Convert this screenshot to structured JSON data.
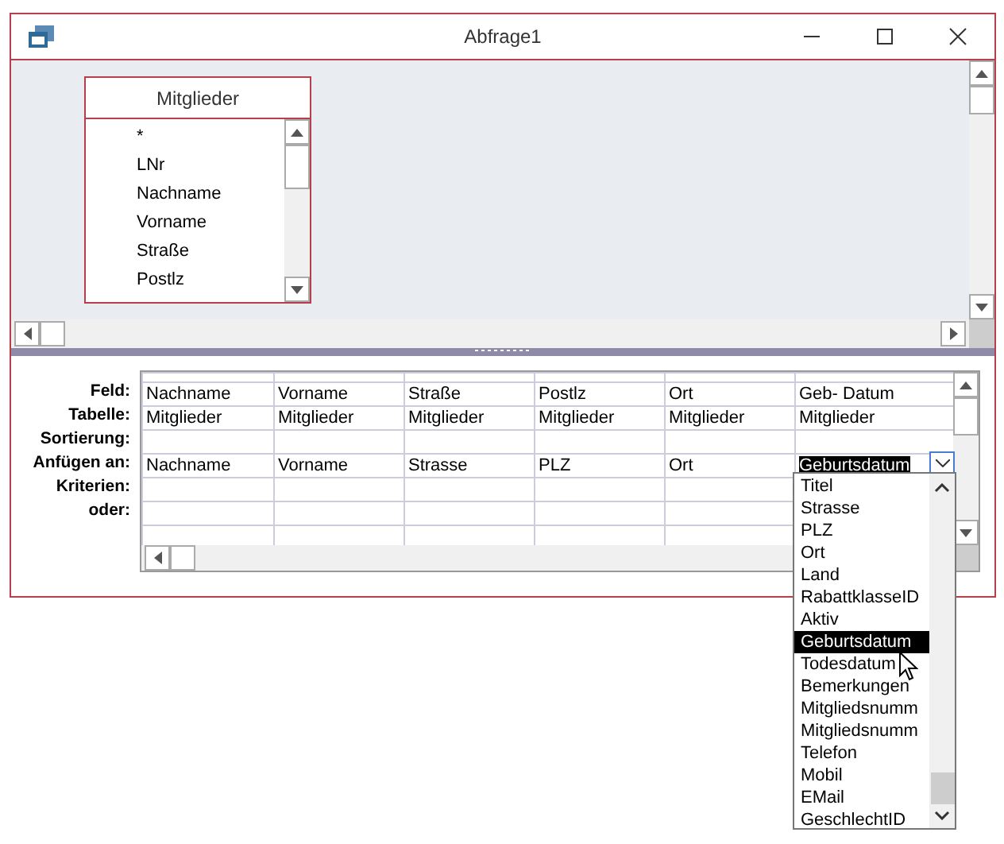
{
  "window": {
    "title": "Abfrage1"
  },
  "table_pane": {
    "tables": [
      {
        "title": "Mitglieder",
        "fields": [
          "*",
          "LNr",
          "Nachname",
          "Vorname",
          "Straße",
          "Postlz"
        ]
      }
    ]
  },
  "grid": {
    "row_labels": [
      "Feld:",
      "Tabelle:",
      "Sortierung:",
      "Anfügen an:",
      "Kriterien:",
      "oder:"
    ],
    "columns": [
      {
        "field": "Nachname",
        "table": "Mitglieder",
        "append_to": "Nachname",
        "editing": false
      },
      {
        "field": "Vorname",
        "table": "Mitglieder",
        "append_to": "Vorname",
        "editing": false
      },
      {
        "field": "Straße",
        "table": "Mitglieder",
        "append_to": "Strasse",
        "editing": false
      },
      {
        "field": "Postlz",
        "table": "Mitglieder",
        "append_to": "PLZ",
        "editing": false
      },
      {
        "field": "Ort",
        "table": "Mitglieder",
        "append_to": "Ort",
        "editing": false
      },
      {
        "field": "Geb- Datum",
        "table": "Mitglieder",
        "append_to": "Geburtsdatum",
        "editing": true
      }
    ]
  },
  "dropdown": {
    "items": [
      {
        "label": "Titel",
        "selected": false
      },
      {
        "label": "Strasse",
        "selected": false
      },
      {
        "label": "PLZ",
        "selected": false
      },
      {
        "label": "Ort",
        "selected": false
      },
      {
        "label": "Land",
        "selected": false
      },
      {
        "label": "RabattklasseID",
        "selected": false
      },
      {
        "label": "Aktiv",
        "selected": false
      },
      {
        "label": "Geburtsdatum",
        "selected": true
      },
      {
        "label": "Todesdatum",
        "selected": false
      },
      {
        "label": "Bemerkungen",
        "selected": false
      },
      {
        "label": "Mitgliedsnumm",
        "selected": false
      },
      {
        "label": "Mitgliedsnumm",
        "selected": false
      },
      {
        "label": "Telefon",
        "selected": false
      },
      {
        "label": "Mobil",
        "selected": false
      },
      {
        "label": "EMail",
        "selected": false
      },
      {
        "label": "GeschlechtID",
        "selected": false
      }
    ]
  }
}
